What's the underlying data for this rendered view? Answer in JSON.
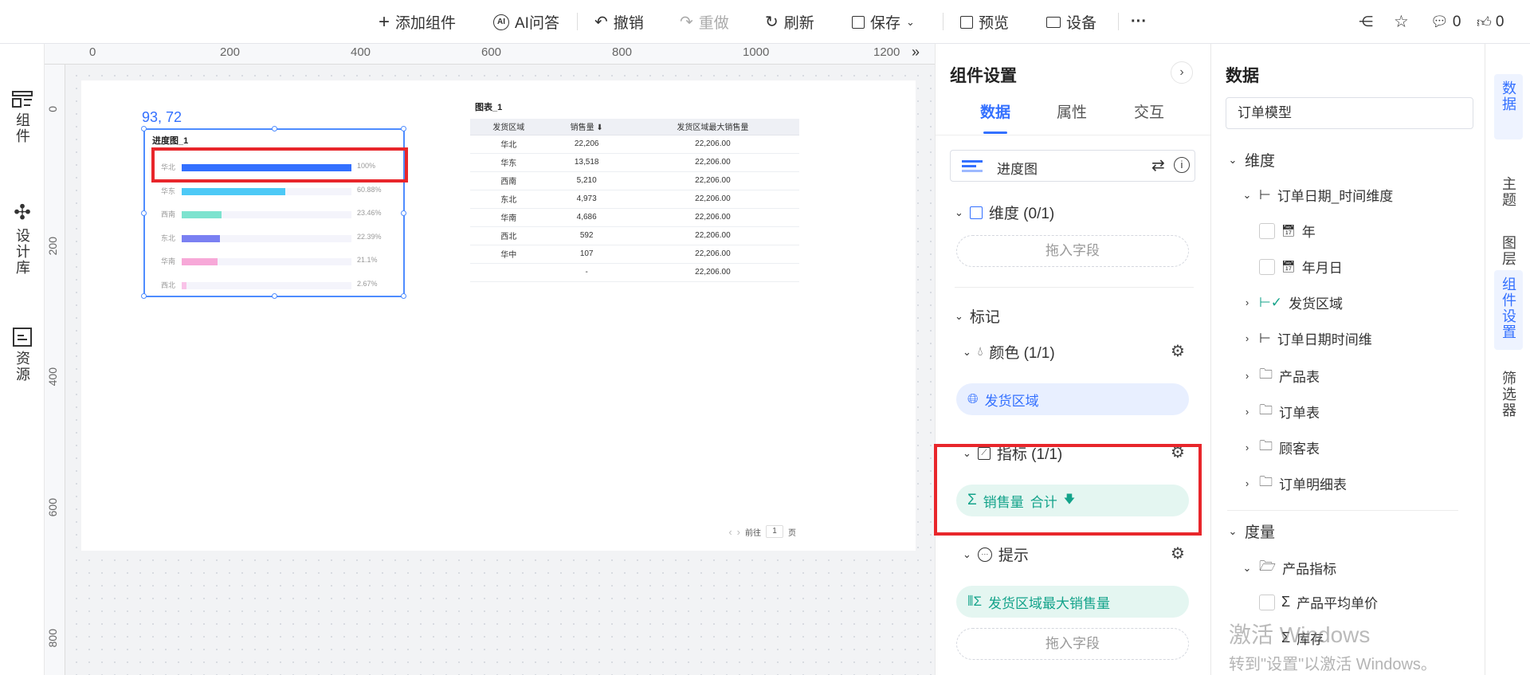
{
  "topbar": {
    "add_component": "添加组件",
    "ai_qa": "AI问答",
    "undo": "撤销",
    "redo": "重做",
    "refresh": "刷新",
    "save": "保存",
    "preview": "预览",
    "device": "设备",
    "more": "···",
    "comment_count": "0",
    "like_count": "0"
  },
  "leftrail": {
    "components": "组件",
    "design_lib": "设计库",
    "resources": "资源"
  },
  "ruler": {
    "top": [
      "0",
      "200",
      "400",
      "600",
      "800",
      "1000",
      "1200"
    ],
    "left": [
      "0",
      "200",
      "400",
      "600",
      "800"
    ]
  },
  "canvas": {
    "coord_readout": "93, 72",
    "progress_widget": {
      "title": "进度图_1",
      "rows": [
        {
          "label": "华北",
          "pct": "100%",
          "value": 1.0,
          "color": "#3370ff"
        },
        {
          "label": "华东",
          "pct": "60.88%",
          "value": 0.6088,
          "color": "#4dc9f6"
        },
        {
          "label": "西南",
          "pct": "23.46%",
          "value": 0.2346,
          "color": "#7de3cf"
        },
        {
          "label": "东北",
          "pct": "22.39%",
          "value": 0.2239,
          "color": "#7a80f2"
        },
        {
          "label": "华南",
          "pct": "21.1%",
          "value": 0.211,
          "color": "#f7a8d8"
        },
        {
          "label": "西北",
          "pct": "2.67%",
          "value": 0.0267,
          "color": "#f9c3e8"
        }
      ]
    },
    "table_widget": {
      "title": "图表_1",
      "headers": [
        "发货区域",
        "销售量 ⬇",
        "发货区域最大销售量"
      ],
      "rows": [
        [
          "华北",
          "22,206",
          "22,206.00"
        ],
        [
          "华东",
          "13,518",
          "22,206.00"
        ],
        [
          "西南",
          "5,210",
          "22,206.00"
        ],
        [
          "东北",
          "4,973",
          "22,206.00"
        ],
        [
          "华南",
          "4,686",
          "22,206.00"
        ],
        [
          "西北",
          "592",
          "22,206.00"
        ],
        [
          "华中",
          "107",
          "22,206.00"
        ],
        [
          "",
          "-",
          "22,206.00"
        ]
      ],
      "pager_prev": "‹",
      "pager_next": "›",
      "goto_label": "前往",
      "page_value": "1",
      "page_suffix": "页"
    }
  },
  "midpanel": {
    "title": "组件设置",
    "collapse": "›",
    "tabs": [
      "数据",
      "属性",
      "交互"
    ],
    "chart_type": "进度图",
    "dimension": "维度 (0/1)",
    "dimension_drop": "拖入字段",
    "mark": "标记",
    "color": "颜色 (1/1)",
    "color_field": "发货区域",
    "indicator": "指标 (1/1)",
    "indicator_field": "销售量",
    "indicator_agg": "合计",
    "tooltip": "提示",
    "tooltip_field": "发货区域最大销售量",
    "tooltip_drop": "拖入字段"
  },
  "datapanel": {
    "title": "数据",
    "model": "订单模型",
    "dimension_group": "维度",
    "order_date_dim": "订单日期_时间维度",
    "year": "年",
    "ymd": "年月日",
    "ship_region": "发货区域",
    "order_date_time": "订单日期时间维",
    "product_table": "产品表",
    "order_table": "订单表",
    "customer_table": "顾客表",
    "order_detail_table": "订单明细表",
    "measure_group": "度量",
    "product_indicators": "产品指标",
    "avg_price": "产品平均单价",
    "stock": "库存"
  },
  "rightrail": {
    "data": "数据",
    "theme": "主题",
    "layers": "图层",
    "component_settings": "组件设置",
    "filter": "筛选器"
  },
  "watermark": {
    "line1": "激活 Windows",
    "line2": "转到\"设置\"以激活 Windows。"
  },
  "colors": {
    "accent": "#3370ff",
    "highlight_red": "#e8262b",
    "pill_blue_bg": "#e8efff",
    "pill_green_bg": "#e4f6f1"
  }
}
